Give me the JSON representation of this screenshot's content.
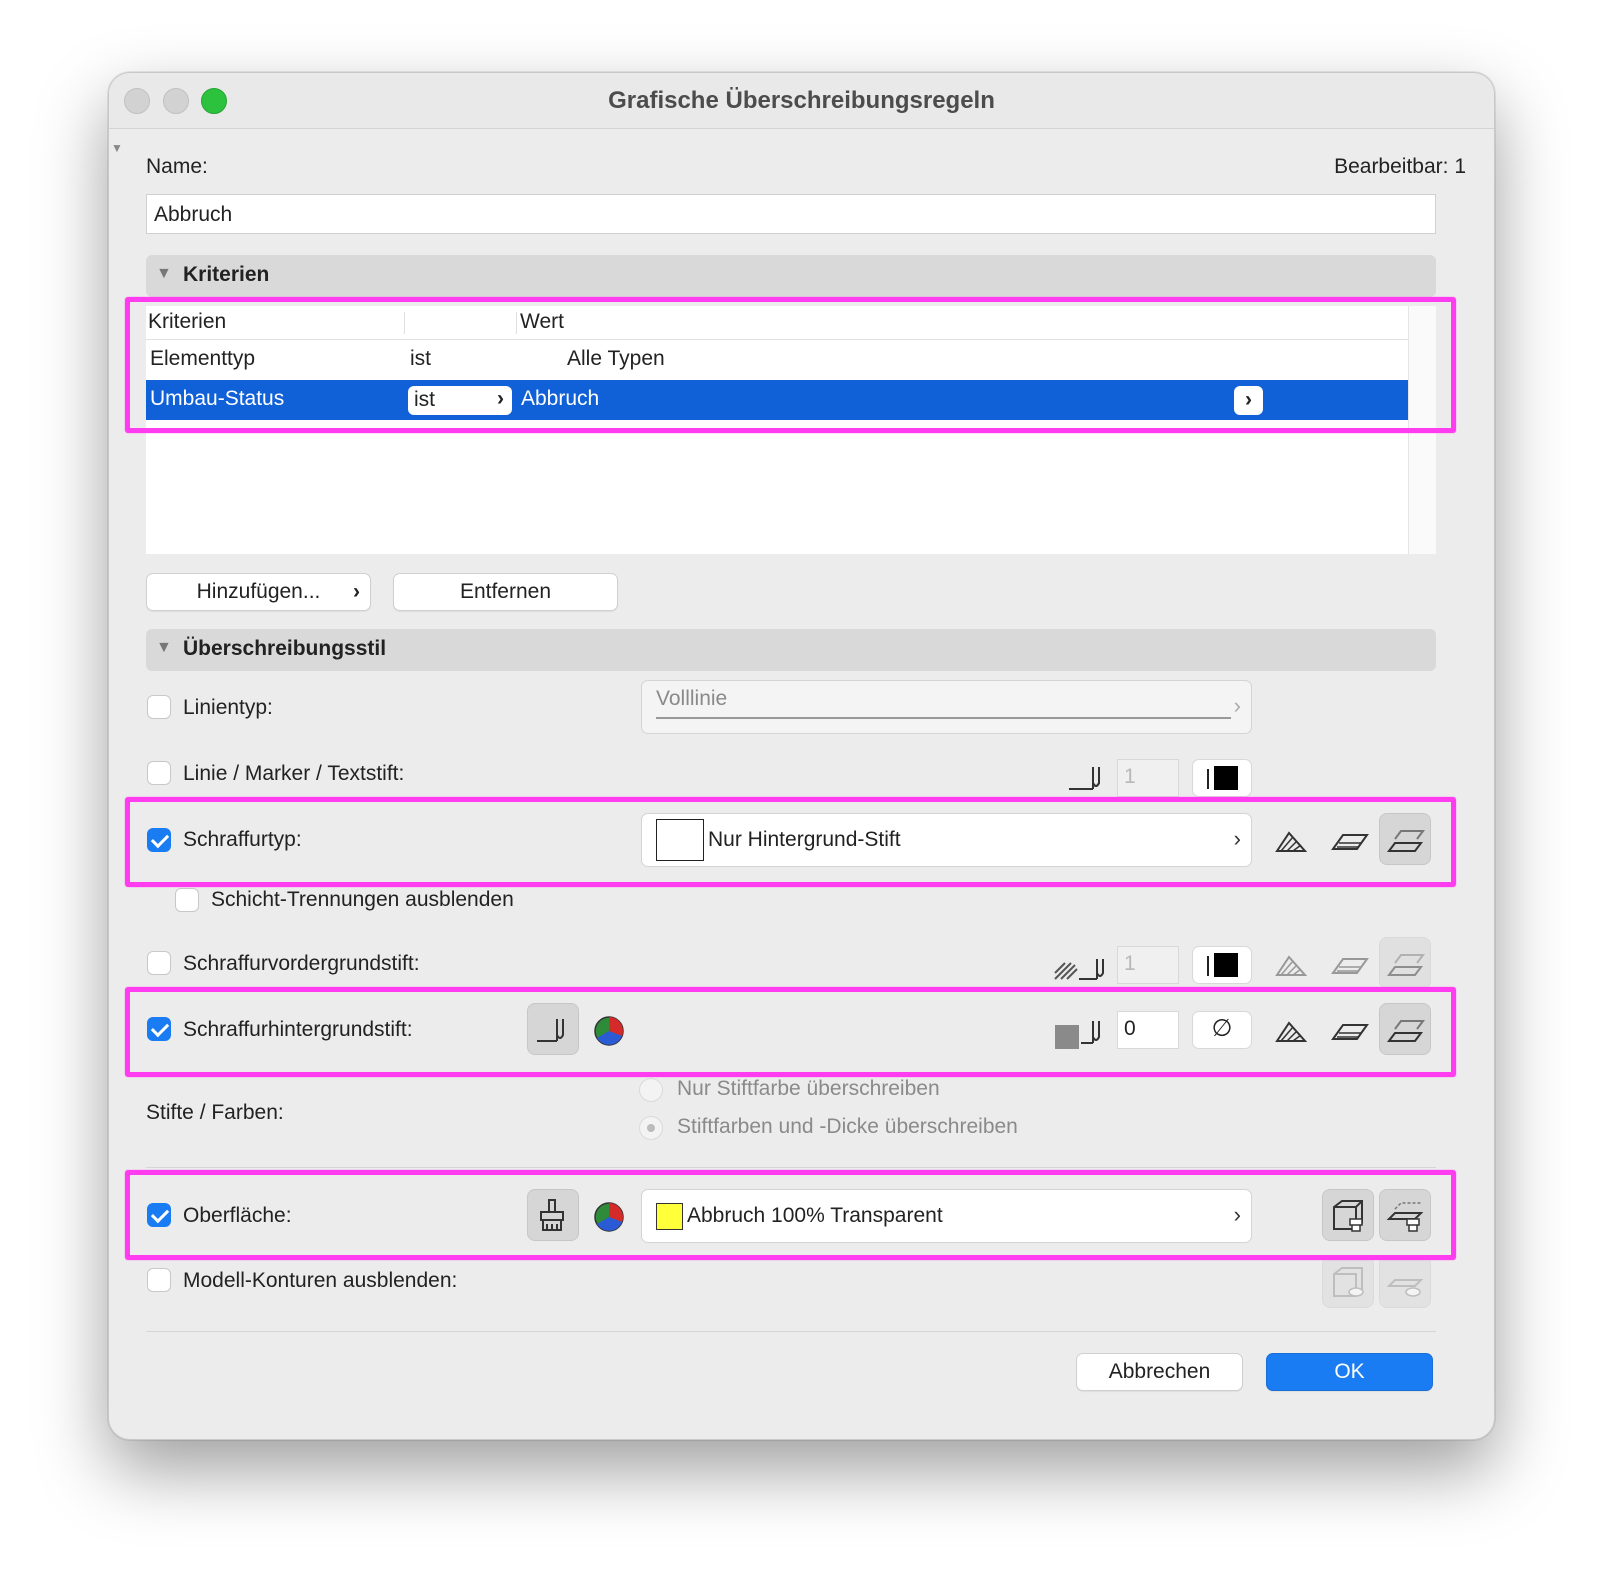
{
  "window": {
    "title": "Grafische Überschreibungsregeln"
  },
  "name_label": "Name:",
  "editable": "Bearbeitbar: 1",
  "name_value": "Abbruch",
  "criteria": {
    "section_title": "Kriterien",
    "headers": [
      "Kriterien",
      "Wert"
    ],
    "rows": [
      {
        "criterion": "Elementtyp",
        "operator": "ist",
        "value": "Alle Typen",
        "selected": false
      },
      {
        "criterion": "Umbau-Status",
        "operator": "ist",
        "value": "Abbruch",
        "selected": true
      }
    ],
    "add_button": "Hinzufügen...",
    "remove_button": "Entfernen"
  },
  "style": {
    "section_title": "Überschreibungsstil",
    "linetype": {
      "label": "Linientyp:",
      "checked": false,
      "value": "Volllinie"
    },
    "line_pen": {
      "label": "Linie / Marker / Textstift:",
      "checked": false,
      "pen": "1"
    },
    "fill_type": {
      "label": "Schraffurtyp:",
      "checked": true,
      "value": "Nur Hintergrund-Stift"
    },
    "hide_layers": {
      "label": "Schicht-Trennungen ausblenden",
      "checked": false
    },
    "fill_fg_pen": {
      "label": "Schraffurvordergrundstift:",
      "checked": false,
      "pen": "1"
    },
    "fill_bg_pen": {
      "label": "Schraffurhintergrundstift:",
      "checked": true,
      "pen": "0",
      "color_symbol": "∅"
    },
    "pens_colors": {
      "label": "Stifte / Farben:",
      "options": [
        "Nur Stiftfarbe überschreiben",
        "Stiftfarben und -Dicke überschreiben"
      ],
      "selected_index": 1
    },
    "surface": {
      "label": "Oberfläche:",
      "checked": true,
      "value": "Abbruch 100% Transparent",
      "swatch_color": "#ffff3a"
    },
    "hide_contours": {
      "label": "Modell-Konturen ausblenden:",
      "checked": false
    }
  },
  "buttons": {
    "cancel": "Abbrechen",
    "ok": "OK"
  },
  "colors": {
    "accent": "#1a7cf2",
    "selection": "#1061d8",
    "highlight": "#ff3cf0"
  }
}
